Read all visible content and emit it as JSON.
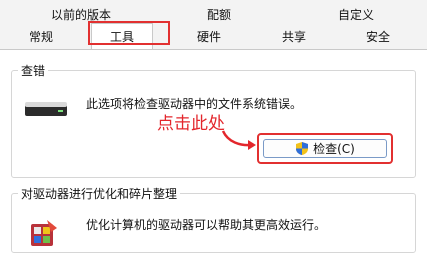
{
  "tabs": [
    {
      "label": "以前的版本",
      "active": false
    },
    {
      "label": "配额",
      "active": false
    },
    {
      "label": "自定义",
      "active": false
    },
    {
      "label": "常规",
      "active": false
    },
    {
      "label": "工具",
      "active": true
    },
    {
      "label": "硬件",
      "active": false
    },
    {
      "label": "共享",
      "active": false
    },
    {
      "label": "安全",
      "active": false
    }
  ],
  "error_check": {
    "title": "查错",
    "description": "此选项将检查驱动器中的文件系统错误。",
    "button_label": "检查(C)",
    "drive_icon": "hard-drive-icon",
    "button_icon": "uac-shield-icon"
  },
  "annotation": {
    "text": "点击此处",
    "color": "#e3262c",
    "icon": "curved-arrow-icon"
  },
  "optimize": {
    "title": "对驱动器进行优化和碎片整理",
    "description": "优化计算机的驱动器可以帮助其更高效运行。",
    "icon": "defrag-icon"
  }
}
